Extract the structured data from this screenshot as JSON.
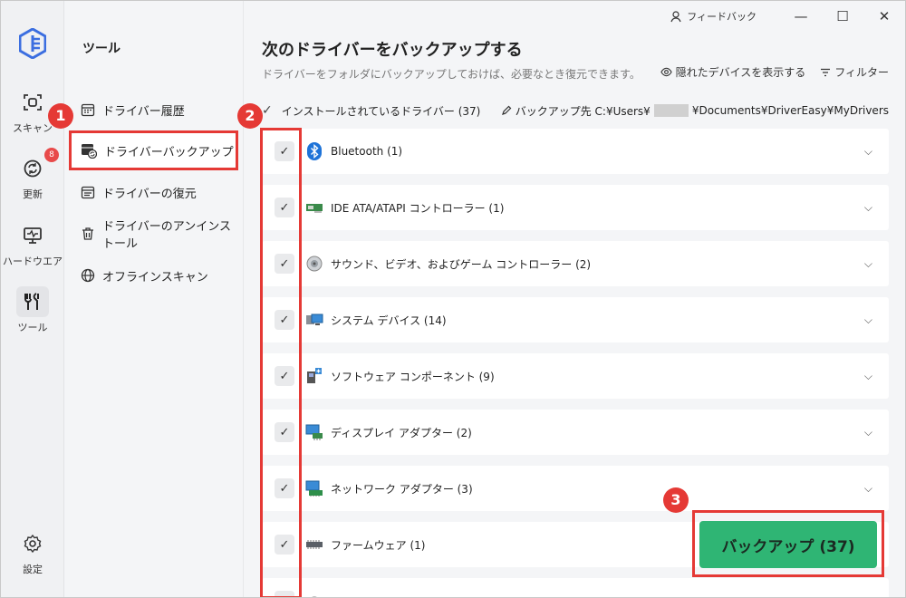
{
  "titlebar": {
    "feedback": "フィードバック",
    "minimize": "—",
    "maximize": "☐",
    "close": "✕"
  },
  "rail": {
    "items": [
      {
        "label": "スキャン"
      },
      {
        "label": "更新",
        "badge": "8"
      },
      {
        "label": "ハードウエア"
      },
      {
        "label": "ツール"
      },
      {
        "label": "設定"
      }
    ]
  },
  "subnav": {
    "title": "ツール",
    "items": [
      {
        "label": "ドライバー履歴"
      },
      {
        "label": "ドライバーバックアップ"
      },
      {
        "label": "ドライバーの復元"
      },
      {
        "label": "ドライバーのアンインストール"
      },
      {
        "label": "オフラインスキャン"
      }
    ]
  },
  "main": {
    "title": "次のドライバーをバックアップする",
    "subtitle": "ドライバーをフォルダにバックアップしておけば、必要なとき復元できます。",
    "show_hidden": "隠れたデバイスを表示する",
    "filter": "フィルター",
    "installed_label": "インストールされているドライバー (37)",
    "path_prefix": "バックアップ先 C:¥Users¥",
    "path_suffix": "¥Documents¥DriverEasy¥MyDrivers",
    "rows": [
      {
        "label": "Bluetooth (1)",
        "icon": "bluetooth-icon"
      },
      {
        "label": "IDE ATA/ATAPI コントローラー (1)",
        "icon": "ide-controller-icon"
      },
      {
        "label": "サウンド、ビデオ、およびゲーム コントローラー (2)",
        "icon": "speaker-icon"
      },
      {
        "label": "システム デバイス (14)",
        "icon": "system-device-icon"
      },
      {
        "label": "ソフトウェア コンポーネント (9)",
        "icon": "software-component-icon"
      },
      {
        "label": "ディスプレイ アダプター (2)",
        "icon": "display-adapter-icon"
      },
      {
        "label": "ネットワーク アダプター (3)",
        "icon": "network-adapter-icon"
      },
      {
        "label": "ファームウェア (1)",
        "icon": "firmware-icon"
      },
      {
        "label": "",
        "icon": "pointing-device-icon"
      }
    ],
    "backup_button": "バックアップ (37)"
  },
  "annotations": [
    "1",
    "2",
    "3"
  ],
  "colors": {
    "accent_green": "#2fb574",
    "annotation_red": "#e53935",
    "badge_red": "#e84a4a"
  }
}
